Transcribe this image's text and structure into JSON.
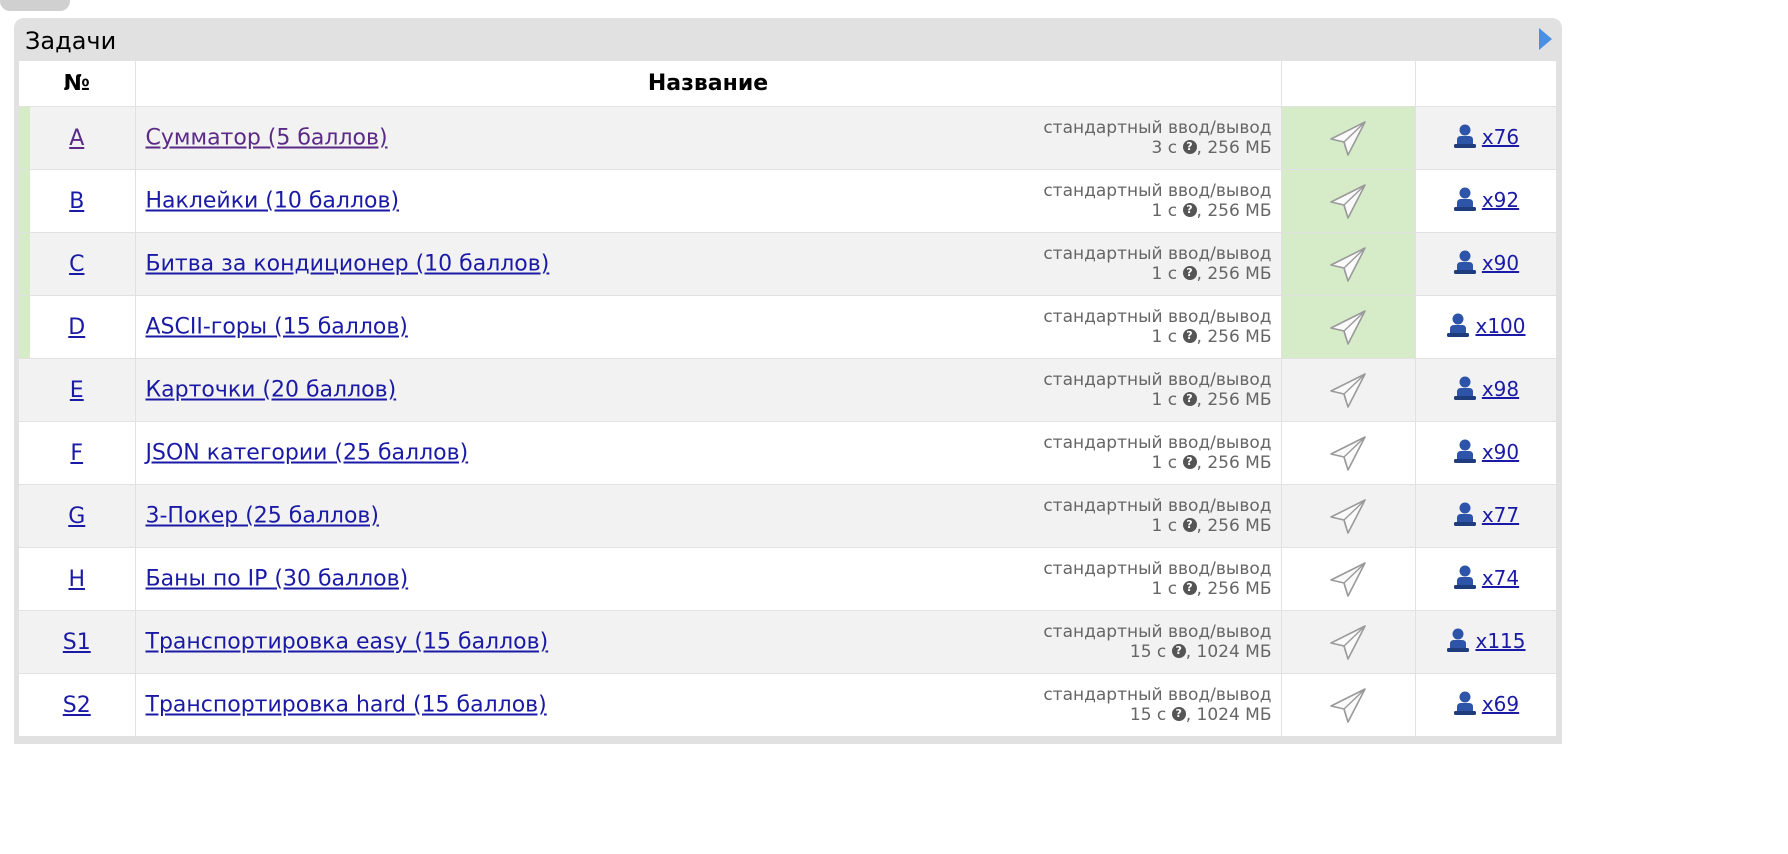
{
  "panel": {
    "title": "Задачи"
  },
  "table": {
    "headers": {
      "number": "№",
      "name": "Название",
      "submit": "",
      "solvers": ""
    },
    "problems": [
      {
        "letter": "A",
        "name": "Сумматор (5 баллов)",
        "io": "стандартный ввод/вывод",
        "time": "3 с",
        "memory": "256 МБ",
        "solvers": "x76",
        "accepted": true,
        "visited": true
      },
      {
        "letter": "B",
        "name": "Наклейки (10 баллов)",
        "io": "стандартный ввод/вывод",
        "time": "1 с",
        "memory": "256 МБ",
        "solvers": "x92",
        "accepted": true,
        "visited": false
      },
      {
        "letter": "C",
        "name": "Битва за кондиционер (10 баллов)",
        "io": "стандартный ввод/вывод",
        "time": "1 с",
        "memory": "256 МБ",
        "solvers": "x90",
        "accepted": true,
        "visited": false
      },
      {
        "letter": "D",
        "name": "ASCII-горы (15 баллов)",
        "io": "стандартный ввод/вывод",
        "time": "1 с",
        "memory": "256 МБ",
        "solvers": "x100",
        "accepted": true,
        "visited": false
      },
      {
        "letter": "E",
        "name": "Карточки (20 баллов)",
        "io": "стандартный ввод/вывод",
        "time": "1 с",
        "memory": "256 МБ",
        "solvers": "x98",
        "accepted": false,
        "visited": false
      },
      {
        "letter": "F",
        "name": "JSON категории (25 баллов)",
        "io": "стандартный ввод/вывод",
        "time": "1 с",
        "memory": "256 МБ",
        "solvers": "x90",
        "accepted": false,
        "visited": false
      },
      {
        "letter": "G",
        "name": "3-Покер (25 баллов)",
        "io": "стандартный ввод/вывод",
        "time": "1 с",
        "memory": "256 МБ",
        "solvers": "x77",
        "accepted": false,
        "visited": false
      },
      {
        "letter": "H",
        "name": "Баны по IP (30 баллов)",
        "io": "стандартный ввод/вывод",
        "time": "1 с",
        "memory": "256 МБ",
        "solvers": "x74",
        "accepted": false,
        "visited": false
      },
      {
        "letter": "S1",
        "name": "Транспортировка easy (15 баллов)",
        "io": "стандартный ввод/вывод",
        "time": "15 с",
        "memory": "1024 МБ",
        "solvers": "x115",
        "accepted": false,
        "visited": false
      },
      {
        "letter": "S2",
        "name": "Транспортировка hard (15 баллов)",
        "io": "стандартный ввод/вывод",
        "time": "15 с",
        "memory": "1024 МБ",
        "solvers": "x69",
        "accepted": false,
        "visited": false
      }
    ]
  },
  "icons": {
    "submit": "paper-plane-icon",
    "solvers": "user-icon",
    "help": "question-circle-icon",
    "collapse": "triangle-right-icon"
  },
  "colors": {
    "link": "#1a1aa6",
    "visited_link": "#5b2a86",
    "accepted_highlight": "#d6ecc8",
    "panel_bg": "#e1e1e1",
    "collapse_arrow": "#4a90e2"
  }
}
